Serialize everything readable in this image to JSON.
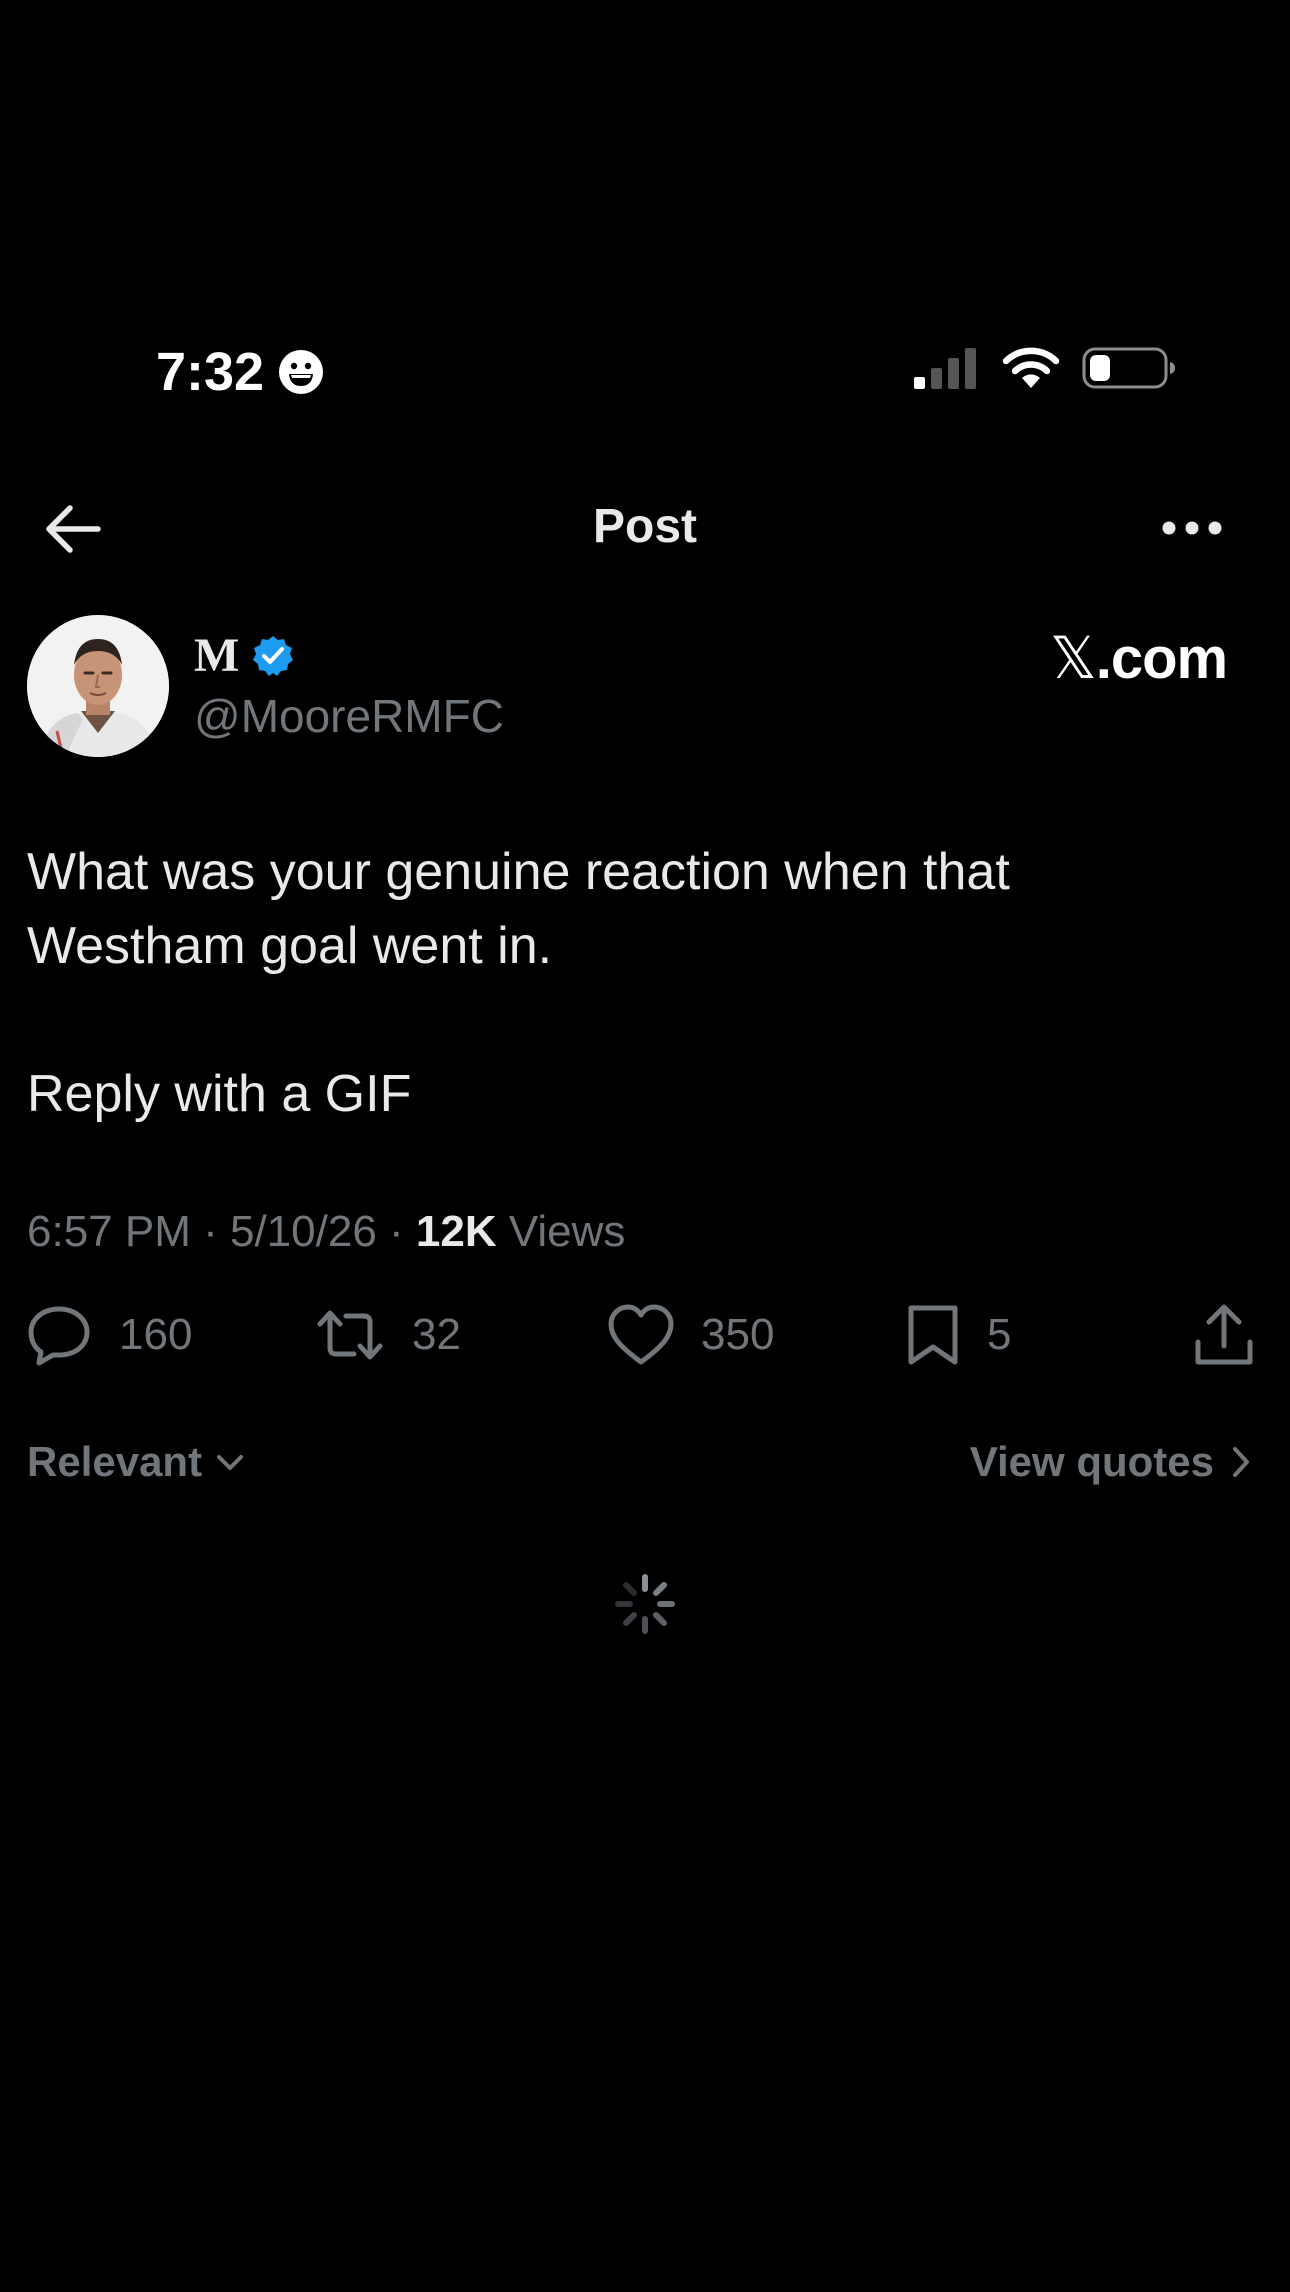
{
  "status_bar": {
    "time": "7:32",
    "emoji_icon": "grinning-face-icon",
    "signal_icon": "cellular-signal-icon",
    "wifi_icon": "wifi-icon",
    "battery_icon": "battery-low-icon"
  },
  "nav": {
    "title": "Post",
    "back_icon": "arrow-left-icon",
    "more_icon": "more-horizontal-icon"
  },
  "author": {
    "name": "M",
    "verified_icon": "verified-badge-icon",
    "handle": "@MooreRMFC",
    "watermark_x": "𝕏",
    "watermark_domain": ".com"
  },
  "post": {
    "line1": "What was your genuine reaction when that",
    "line2": "Westham goal went in.",
    "line3": "Reply with a GIF"
  },
  "meta": {
    "time": "6:57 PM",
    "separator1": " · ",
    "date": "5/10/26",
    "separator2": " · ",
    "views_count": "12K",
    "views_label": " Views"
  },
  "actions": {
    "replies": "160",
    "reposts": "32",
    "likes": "350",
    "bookmarks": "5"
  },
  "sort": {
    "label": "Relevant",
    "quotes_label": "View quotes"
  },
  "colors": {
    "background": "#000000",
    "text": "#e7e9ea",
    "secondary": "#71767b",
    "verified": "#1d9bf0"
  }
}
